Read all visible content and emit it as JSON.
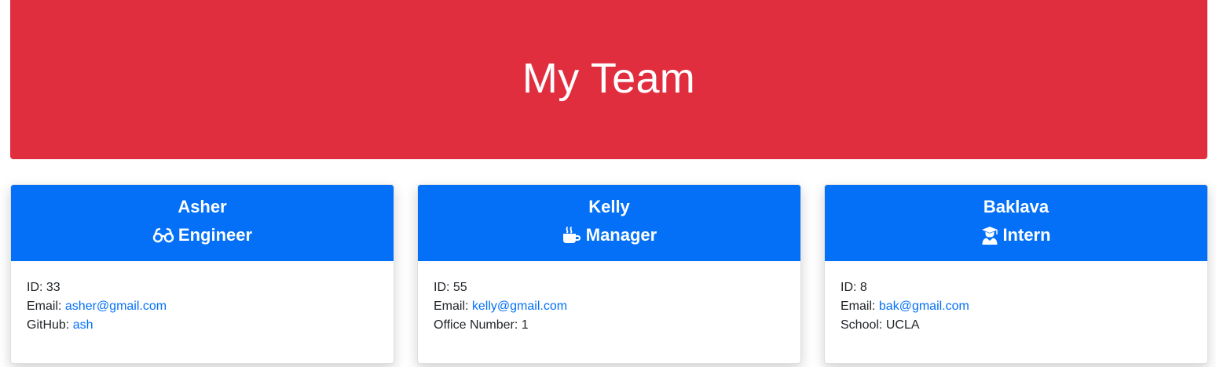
{
  "header": {
    "title": "My Team",
    "background_color": "#e02e3f"
  },
  "accent_color": "#0370f7",
  "team": [
    {
      "name": "Asher",
      "role": "Engineer",
      "role_icon": "glasses-icon",
      "id_label": "ID:",
      "id": "33",
      "email_label": "Email:",
      "email": "asher@gmail.com",
      "extra_label": "GitHub:",
      "extra_value": "ash"
    },
    {
      "name": "Kelly",
      "role": "Manager",
      "role_icon": "coffee-mug-icon",
      "id_label": "ID:",
      "id": "55",
      "email_label": "Email:",
      "email": "kelly@gmail.com",
      "extra_label": "Office Number:",
      "extra_value": "1"
    },
    {
      "name": "Baklava",
      "role": "Intern",
      "role_icon": "graduate-icon",
      "id_label": "ID:",
      "id": "8",
      "email_label": "Email:",
      "email": "bak@gmail.com",
      "extra_label": "School:",
      "extra_value": "UCLA"
    }
  ]
}
